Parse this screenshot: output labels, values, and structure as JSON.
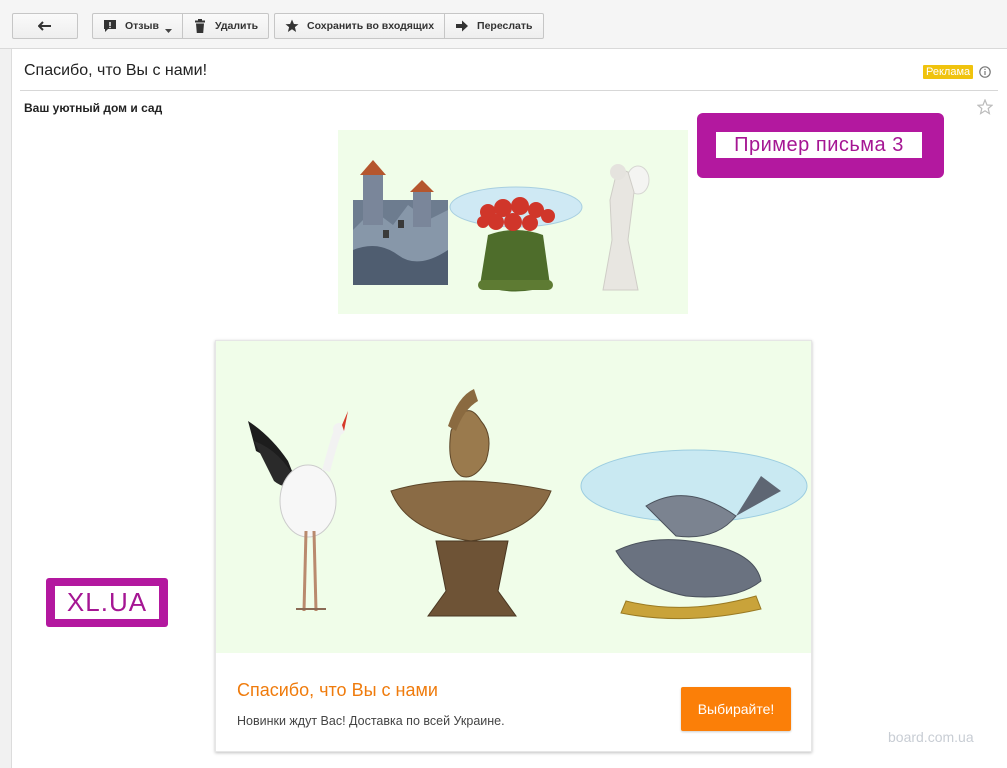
{
  "toolbar": {
    "back_icon": "arrow-left-icon",
    "report_label": "Отзыв",
    "delete_label": "Удалить",
    "save_label": "Сохранить во входящих",
    "forward_label": "Переслать"
  },
  "message": {
    "subject": "Спасибо, что Вы с нами!",
    "ad_badge": "Реклама",
    "sender": "Ваш уютный дом и сад"
  },
  "overlays": {
    "example_label": "Пример письма 3",
    "site_label": "XL.UA"
  },
  "card": {
    "title": "Спасибо, что Вы с нами",
    "text": "Новинки ждут Вас! Доставка по всей Украине.",
    "cta_label": "Выбирайте!"
  },
  "watermark": "board.com.ua",
  "colors": {
    "accent_orange": "#fb7f08",
    "badge_yellow": "#f0c30d",
    "label_magenta": "#b3189f",
    "banner_bg": "#f0fde9"
  }
}
